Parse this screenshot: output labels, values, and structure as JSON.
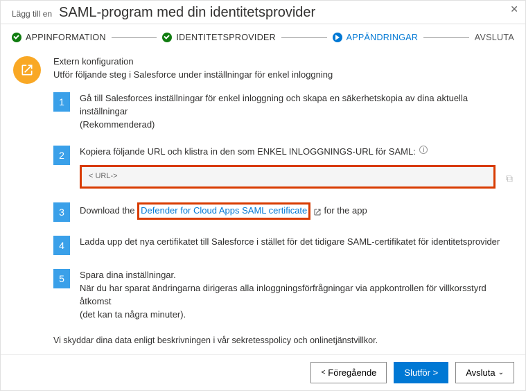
{
  "header": {
    "prefix": "Lägg till en",
    "title": "SAML-program med din identitetsprovider"
  },
  "wizard": {
    "step1": "APPINFORMATION",
    "step2": "IDENTITETSPROVIDER",
    "step3": "APPÄNDRINGAR",
    "step4": "AVSLUTA"
  },
  "external": {
    "heading": "Extern konfiguration",
    "sub": "Utför följande steg i Salesforce under inställningar för enkel inloggning"
  },
  "instructions": {
    "s1": "Gå till Salesforces inställningar för enkel inloggning och skapa en säkerhetskopia av dina aktuella inställningar",
    "s1b": "(Rekommenderad)",
    "s2": "Kopiera följande URL och klistra in den som ENKEL INLOGGNINGS-URL för SAML:",
    "s2url": "< URL-&gt;",
    "s3a": "Download the",
    "s3link": "Defender for Cloud Apps SAML certificate",
    "s3b": "for the app",
    "s4": "Ladda upp det nya certifikatet till Salesforce i stället för det tidigare SAML-certifikatet för identitetsprovider",
    "s5a": "Spara dina inställningar.",
    "s5b": "När du har sparat ändringarna dirigeras alla inloggningsförfrågningar via appkontrollen för villkorsstyrd åtkomst",
    "s5c": "(det kan ta några minuter)."
  },
  "privacy": "Vi skyddar dina data enligt beskrivningen i vår sekretesspolicy och onlinetjänstvillkor.",
  "footer": {
    "prev": "Föregående",
    "finish": "Slutför &gt;",
    "close": "Avsluta"
  },
  "numbers": {
    "n1": "1",
    "n2": "2",
    "n3": "3",
    "n4": "4",
    "n5": "5"
  }
}
